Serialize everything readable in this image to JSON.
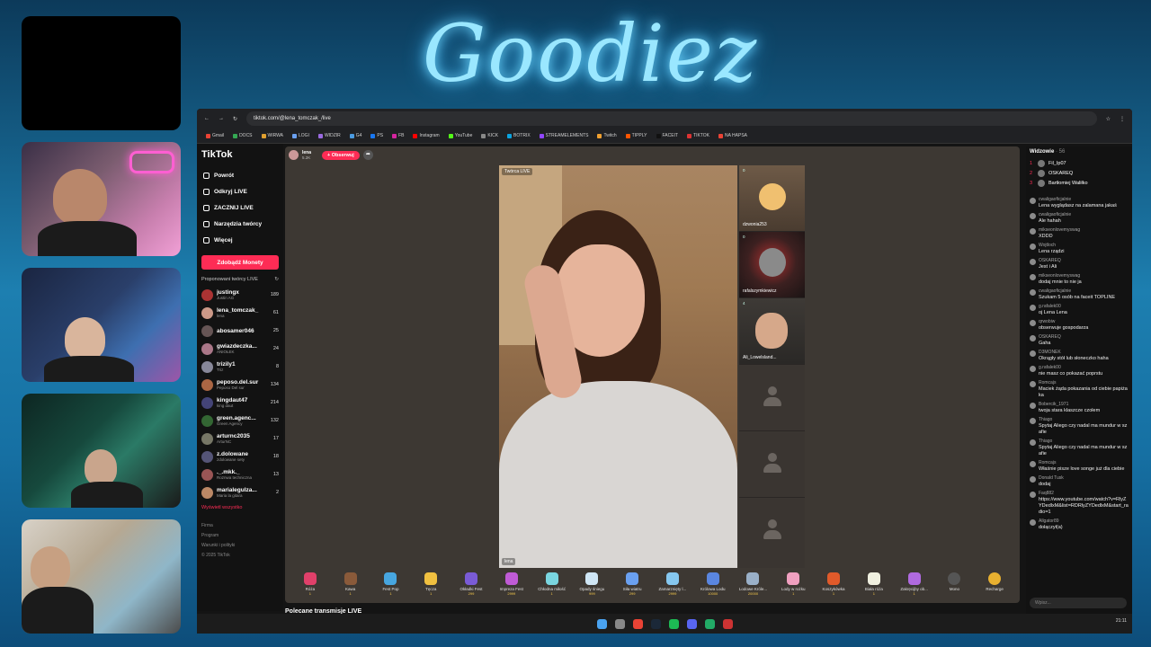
{
  "overlay": {
    "title": "Goodiez"
  },
  "browser": {
    "url": "tiktok.com/@lena_tomczak_/live",
    "bookmarks": [
      "Gmail",
      "DOCS",
      "WIRWA",
      "LOGI",
      "WIDZIR",
      "G4",
      "PS",
      "FB",
      "Instagram",
      "YouTube",
      "KICK",
      "BOTRIX",
      "STREAMELEMENTS",
      "Twitch",
      "TIPPLY",
      "FACEIT",
      "TIKTOK",
      "NA HAPSA"
    ]
  },
  "tiktok": {
    "logo": "TikTok",
    "nav": [
      {
        "label": "Powrót",
        "icon": "back-icon"
      },
      {
        "label": "Odkryj LIVE",
        "icon": "explore-icon"
      },
      {
        "label": "ZACZNIJ LIVE",
        "icon": "live-icon"
      },
      {
        "label": "Narzędzia twórcy",
        "icon": "tools-icon"
      },
      {
        "label": "Więcej",
        "icon": "more-icon"
      }
    ],
    "coins_button": "Zdobądź Monety",
    "suggested_title": "Proponowani twórcy LIVE",
    "creators": [
      {
        "name": "justingx",
        "sub": "Justin AG",
        "count": "189",
        "color": "#a33"
      },
      {
        "name": "lena_tomczak_",
        "sub": "lena",
        "count": "61",
        "color": "#c98"
      },
      {
        "name": "abosamer046",
        "sub": "",
        "count": "25",
        "color": "#655"
      },
      {
        "name": "gwiazdeczka...",
        "sub": "ANIOŁEK",
        "count": "24",
        "color": "#a78"
      },
      {
        "name": "trizily1",
        "sub": "Triz",
        "count": "8",
        "color": "#889"
      },
      {
        "name": "peposo.del.sur",
        "sub": "Peposo Del sur",
        "count": "134",
        "color": "#a64"
      },
      {
        "name": "kingdaut47",
        "sub": "king daut",
        "count": "214",
        "color": "#447"
      },
      {
        "name": "green.agenc...",
        "sub": "Green Agency",
        "count": "132",
        "color": "#363"
      },
      {
        "name": "arturnc2035",
        "sub": "ArturNC",
        "count": "17",
        "color": "#776"
      },
      {
        "name": "z.dolowane",
        "sub": "zdolowane sety",
        "count": "18",
        "color": "#557"
      },
      {
        "name": "._.mkk._",
        "sub": "Roznwa techniczna",
        "count": "13",
        "color": "#955"
      },
      {
        "name": "marialegulza...",
        "sub": "Maria la gitara",
        "count": "2",
        "color": "#b86"
      }
    ],
    "show_all": "Wyświetl wszystko",
    "footer": [
      "Firma",
      "Program",
      "Warunki i polityki",
      "© 2025 TikTok"
    ],
    "host": {
      "name": "lena",
      "likes": "5.2K",
      "follow": "+ Obserwuj"
    },
    "video_tag": "Twórca LIVE",
    "video_name": "lena",
    "guests": [
      {
        "name": "dzwonia253",
        "score": "0"
      },
      {
        "name": "rafalszymkiewicz",
        "score": "0"
      },
      {
        "name": "Ali_Lowelsland...",
        "score": "4"
      }
    ],
    "gifts": [
      {
        "name": "Róża",
        "price": "1",
        "color": "#e0406a"
      },
      {
        "name": "Kawa",
        "price": "1",
        "color": "#8a5a3a"
      },
      {
        "name": "Fest Pop",
        "price": "1",
        "color": "#47a6e0"
      },
      {
        "name": "Tęcza",
        "price": "1",
        "color": "#f0c040"
      },
      {
        "name": "Okładki Fest",
        "price": "299",
        "color": "#7a5bd6"
      },
      {
        "name": "Impreza Fest",
        "price": "2999",
        "color": "#c05bd6"
      },
      {
        "name": "Chłodna miłość",
        "price": "1",
        "color": "#7ad6e0"
      },
      {
        "name": "Opady śniegu",
        "price": "999",
        "color": "#cfe6f5"
      },
      {
        "name": "Siła wiatru",
        "price": "299",
        "color": "#6aa0f0"
      },
      {
        "name": "Zamarznięty l...",
        "price": "2999",
        "color": "#86c8f0"
      },
      {
        "name": "Królowa Lodu",
        "price": "10000",
        "color": "#5a86e0"
      },
      {
        "name": "Lodowe Króle...",
        "price": "20000",
        "color": "#9ab0c8"
      },
      {
        "name": "Lody w rożku",
        "price": "1",
        "color": "#f0a0c0"
      },
      {
        "name": "Koszykówka",
        "price": "1",
        "color": "#e05a2a"
      },
      {
        "name": "Biała róża",
        "price": "1",
        "color": "#f0f0e0"
      },
      {
        "name": "Zakręcijby ob...",
        "price": "1",
        "color": "#b06ae0"
      },
      {
        "name": "Mono",
        "price": "",
        "color": "#555"
      },
      {
        "name": "Recharge",
        "price": "",
        "color": "#e8b030"
      }
    ],
    "recommended": "Polecane transmisje LIVE"
  },
  "chat": {
    "viewers_label": "Widzowie",
    "viewers_count": "· 56",
    "top_viewers": [
      {
        "rank": "1",
        "name": "Fil_Ip07"
      },
      {
        "rank": "2",
        "name": "OSKAREQ"
      },
      {
        "rank": "3",
        "name": "Bartłomiej Waliłko"
      }
    ],
    "messages": [
      {
        "user": "cwaligaoficjalnie",
        "text": "Lena wyglądasz na zalamana jakaś"
      },
      {
        "user": "cwaligaoficjalnie",
        "text": "Ale hahah"
      },
      {
        "user": "mikseonlovemyswag",
        "text": "XDDD"
      },
      {
        "user": "Wojtloch",
        "text": "Lena rządzi"
      },
      {
        "user": "OSKAREQ",
        "text": "Jest i Ali"
      },
      {
        "user": "mikseonlovemyswag",
        "text": "dodaj mnie to nie ja"
      },
      {
        "user": "cwaligaoficjalnie",
        "text": "Szukam 5 osób na faceit TOPLINE"
      },
      {
        "user": "g.rafalek00",
        "text": "oj Lena Lena"
      },
      {
        "user": "qrwobiw",
        "text": "obserwuje gospodarza"
      },
      {
        "user": "OSKAREQ",
        "text": "Gaha"
      },
      {
        "user": "D3MONEK",
        "text": "Okrągły stół lub słoneczko haha"
      },
      {
        "user": "g.rafalek00",
        "text": "nie masz co pokazać poprstu"
      },
      {
        "user": "Romcajs",
        "text": "Maciek żąda pokazania od ciebie papiżaka"
      },
      {
        "user": "Bobercik_1971",
        "text": "twoja stara klaszcze czołem"
      },
      {
        "user": "Thiago",
        "text": "Spytaj Aliego czy nadal ma mundur w szafie"
      },
      {
        "user": "Thiago",
        "text": "Spytaj Aliego czy nadal ma mundur w szafie"
      },
      {
        "user": "Romcajs",
        "text": "Właśnie pisze love songe już dla ciebie"
      },
      {
        "user": "Donald Tusk",
        "text": "dodaj"
      },
      {
        "user": "Faq882",
        "text": "https://www.youtube.com/watch?v=RlyZYDedlxM&list=RDRlyZYDedlxM&start_radio=1"
      },
      {
        "user": "Allgator89",
        "text": "dołączył(a)"
      }
    ],
    "input_placeholder": "Wpisz..."
  },
  "taskbar": {
    "apps": [
      "windows",
      "search",
      "chrome",
      "steam",
      "spotify",
      "discord",
      "app",
      "obs"
    ],
    "clock": "21:11"
  }
}
